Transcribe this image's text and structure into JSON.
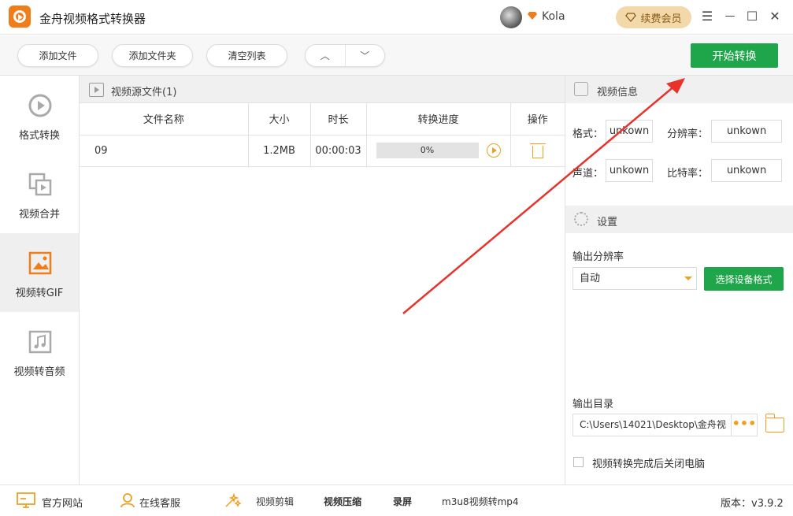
{
  "app": {
    "title": "金舟视频格式转换器"
  },
  "user": {
    "name": "Kola",
    "renew_label": "续费会员"
  },
  "window_controls": {
    "menu": "☰",
    "minimize": "—",
    "maximize": "☐",
    "close": "✕"
  },
  "toolbar": {
    "add_file": "添加文件",
    "add_folder": "添加文件夹",
    "clear_list": "清空列表",
    "move_up": "︿",
    "move_down": "﹀",
    "start": "开始转换"
  },
  "sidebar": {
    "items": [
      {
        "label": "格式转换",
        "icon": "format-convert-icon",
        "active": false
      },
      {
        "label": "视频合并",
        "icon": "video-merge-icon",
        "active": false
      },
      {
        "label": "视频转GIF",
        "icon": "video-to-gif-icon",
        "active": true
      },
      {
        "label": "视频转音频",
        "icon": "video-to-audio-icon",
        "active": false
      }
    ]
  },
  "files": {
    "header": "视频源文件(1)",
    "columns": [
      "文件名称",
      "大小",
      "时长",
      "转换进度",
      "操作"
    ],
    "rows": [
      {
        "name": "09",
        "size": "1.2MB",
        "duration": "00:00:03",
        "progress": "0%"
      }
    ]
  },
  "video_info": {
    "header": "视频信息",
    "format_label": "格式：",
    "format_value": "unkown",
    "resolution_label": "分辨率：",
    "resolution_value": "unkown",
    "channel_label": "声道：",
    "channel_value": "unkown",
    "bitrate_label": "比特率：",
    "bitrate_value": "unkown"
  },
  "settings": {
    "header": "设置",
    "output_resolution_label": "输出分辨率",
    "output_resolution_value": "自动",
    "device_format_button": "选择设备格式",
    "output_dir_label": "输出目录",
    "output_dir_value": "C:\\Users\\14021\\Desktop\\金舟视",
    "more_button": "•••",
    "shutdown_label": "视频转换完成后关闭电脑"
  },
  "footer": {
    "website": "官方网站",
    "support": "在线客服",
    "video_edit": "视频剪辑",
    "video_compress": "视频压缩",
    "record": "录屏",
    "m3u8": "m3u8视频转mp4",
    "version": "版本：v3.9.2"
  },
  "colors": {
    "accent_green": "#1fa54a",
    "accent_orange": "#f0a020",
    "annotation_red": "#e8322a"
  }
}
